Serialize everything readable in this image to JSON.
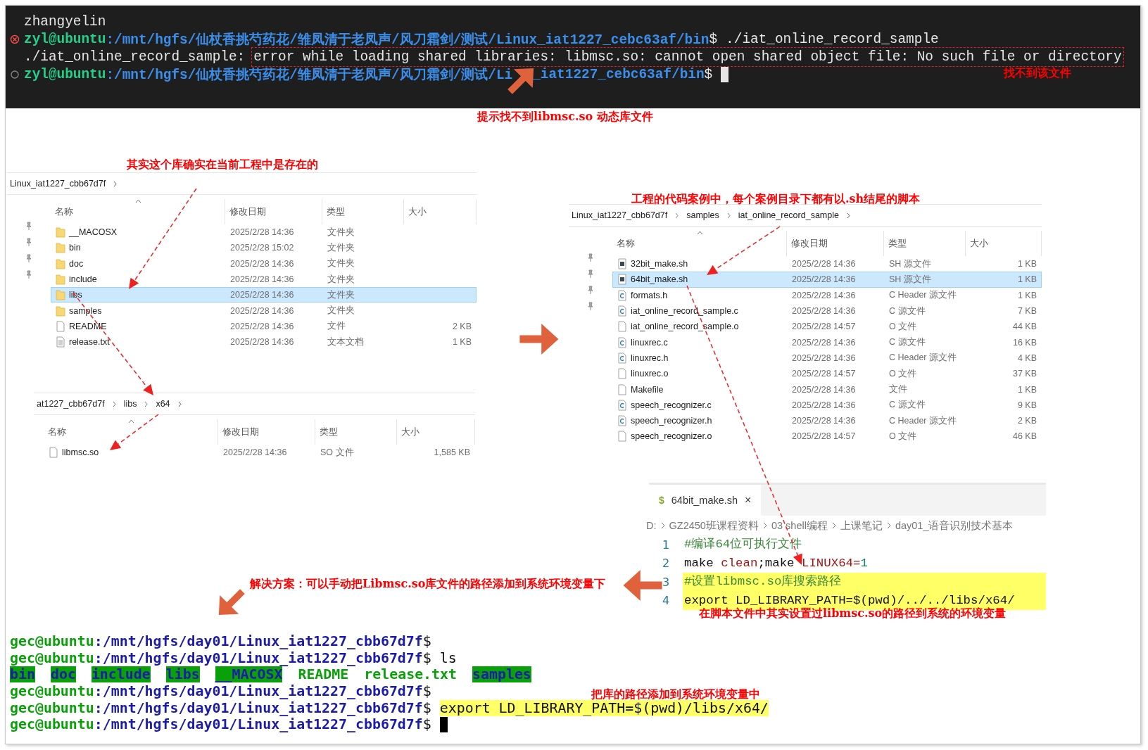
{
  "terminal_top": {
    "lines": [
      {
        "kind": "plain",
        "text": "zhangyelin"
      },
      {
        "kind": "failed-prompt",
        "user": "zyl@ubuntu",
        "path": ":/mnt/hgfs/仙杖香挑芍药花/雏凤清于老凤声/风刀霜剑/测试/Linux_iat1227_cebc63af/bin",
        "symbol": "$",
        "command": "./iat_online_record_sample"
      },
      {
        "kind": "output",
        "text": "./iat_online_record_sample:",
        "marked": "error while loading shared libraries: libmsc.so: cannot open shared object file: No such file or directory"
      },
      {
        "kind": "idle-prompt",
        "user": "zyl@ubuntu",
        "path": ":/mnt/hgfs/仙杖香挑芍药花/雏凤清于老凤声/风刀霜剑/测试/Li",
        "path_rest": "_iat1227_cebc63af/bin",
        "symbol": "$",
        "cursor": true
      }
    ]
  },
  "notes": [
    {
      "text": "找不到该文件"
    },
    {
      "text": "提示找不到libmsc.so 动态库文件"
    },
    {
      "text": "其实这个库确实在当前工程中是存在的"
    },
    {
      "text": "工程的代码案例中，每个案例目录下都有以.sh结尾的脚本"
    },
    {
      "text": "在脚本文件中其实设置过libmsc.so的路径到系统的环境变量"
    },
    {
      "text": "解决方案：可以手动把Libmsc.so库文件的路径添加到系统环境变量下"
    },
    {
      "text": "把库的路径添加到系统环境变量中"
    }
  ],
  "explorers": [
    {
      "breadcrumb": [
        "Linux_iat1227_cbb67d7f"
      ],
      "columns": [
        "名称",
        "修改日期",
        "类型",
        "大小"
      ],
      "rows": [
        {
          "kind": "folder",
          "name": "__MACOSX",
          "date": "2025/2/28 14:36",
          "type": "文件夹",
          "selected": false
        },
        {
          "kind": "folder",
          "name": "bin",
          "date": "2025/2/28 15:02",
          "type": "文件夹",
          "selected": false
        },
        {
          "kind": "folder",
          "name": "doc",
          "date": "2025/2/28 14:36",
          "type": "文件夹",
          "selected": false
        },
        {
          "kind": "folder",
          "name": "include",
          "date": "2025/2/28 14:36",
          "type": "文件夹",
          "selected": false
        },
        {
          "kind": "folder",
          "name": "libs",
          "date": "2025/2/28 14:36",
          "type": "文件夹",
          "selected": true
        },
        {
          "kind": "folder",
          "name": "samples",
          "date": "2025/2/28 14:36",
          "type": "文件夹",
          "selected": false
        },
        {
          "kind": "file",
          "name": "README",
          "date": "2025/2/28 14:36",
          "type": "文件",
          "size": "2 KB",
          "selected": false
        },
        {
          "kind": "text",
          "name": "release.txt",
          "date": "2025/2/28 14:36",
          "type": "文本文档",
          "size": "1 KB",
          "selected": false
        }
      ]
    },
    {
      "breadcrumb": [
        "at1227_cbb67d7f",
        "libs",
        "x64"
      ],
      "columns": [
        "名称",
        "修改日期",
        "类型",
        "大小"
      ],
      "rows": [
        {
          "kind": "file",
          "name": "libmsc.so",
          "date": "2025/2/28 14:36",
          "type": "SO 文件",
          "size": "1,585 KB",
          "selected": false
        }
      ]
    },
    {
      "breadcrumb": [
        "Linux_iat1227_cbb67d7f",
        "samples",
        "iat_online_record_sample"
      ],
      "columns": [
        "名称",
        "修改日期",
        "类型",
        "大小"
      ],
      "rows": [
        {
          "kind": "sh",
          "name": "32bit_make.sh",
          "date": "2025/2/28 14:36",
          "type": "SH 源文件",
          "size": "1 KB",
          "selected": false
        },
        {
          "kind": "sh",
          "name": "64bit_make.sh",
          "date": "2025/2/28 14:36",
          "type": "SH 源文件",
          "size": "1 KB",
          "selected": true
        },
        {
          "kind": "c",
          "name": "formats.h",
          "date": "2025/2/28 14:36",
          "type": "C Header 源文件",
          "size": "1 KB",
          "selected": false
        },
        {
          "kind": "c",
          "name": "iat_online_record_sample.c",
          "date": "2025/2/28 14:36",
          "type": "C 源文件",
          "size": "7 KB",
          "selected": false
        },
        {
          "kind": "file",
          "name": "iat_online_record_sample.o",
          "date": "2025/2/28 14:57",
          "type": "O 文件",
          "size": "44 KB",
          "selected": false
        },
        {
          "kind": "c",
          "name": "linuxrec.c",
          "date": "2025/2/28 14:36",
          "type": "C 源文件",
          "size": "16 KB",
          "selected": false
        },
        {
          "kind": "c",
          "name": "linuxrec.h",
          "date": "2025/2/28 14:36",
          "type": "C Header 源文件",
          "size": "4 KB",
          "selected": false
        },
        {
          "kind": "file",
          "name": "linuxrec.o",
          "date": "2025/2/28 14:57",
          "type": "O 文件",
          "size": "37 KB",
          "selected": false
        },
        {
          "kind": "file",
          "name": "Makefile",
          "date": "2025/2/28 14:36",
          "type": "文件",
          "size": "1 KB",
          "selected": false
        },
        {
          "kind": "c",
          "name": "speech_recognizer.c",
          "date": "2025/2/28 14:36",
          "type": "C 源文件",
          "size": "9 KB",
          "selected": false
        },
        {
          "kind": "c",
          "name": "speech_recognizer.h",
          "date": "2025/2/28 14:36",
          "type": "C Header 源文件",
          "size": "2 KB",
          "selected": false
        },
        {
          "kind": "file",
          "name": "speech_recognizer.o",
          "date": "2025/2/28 14:57",
          "type": "O 文件",
          "size": "46 KB",
          "selected": false
        }
      ]
    }
  ],
  "editor": {
    "tab": {
      "icon": "$",
      "label": "64bit_make.sh",
      "close": "×"
    },
    "breadcrumb": [
      "D:",
      "GZ2450班课程资料",
      "03 shell编程",
      "上课笔记",
      "day01_语音识别技术基本"
    ],
    "lines": [
      {
        "number": "1",
        "highlighted": false,
        "tokens": [
          {
            "kind": "comment",
            "text": "#编译64位可执行文件"
          }
        ]
      },
      {
        "number": "2",
        "highlighted": false,
        "tokens": [
          {
            "kind": "plain",
            "text": "make "
          },
          {
            "kind": "string",
            "text": "clean"
          },
          {
            "kind": "plain",
            "text": ";make "
          },
          {
            "kind": "string",
            "text": "LINUX64="
          },
          {
            "kind": "number",
            "text": "1"
          }
        ]
      },
      {
        "number": "3",
        "highlighted": true,
        "tokens": [
          {
            "kind": "comment",
            "text": "#设置libmsc.so库搜索路径"
          }
        ]
      },
      {
        "number": "4",
        "highlighted": true,
        "tokens": [
          {
            "kind": "plain",
            "text": "export LD_LIBRARY_PATH=$(pwd)/../../libs/x64/"
          }
        ]
      }
    ]
  },
  "terminal_bottom": {
    "lines": [
      {
        "kind": "prompt",
        "user": "gec@ubuntu",
        "path": ":/mnt/hgfs/day01/Linux_iat1227_cbb67d7f",
        "symbol": "$"
      },
      {
        "kind": "prompt",
        "user": "gec@ubuntu",
        "path": ":/mnt/hgfs/day01/Linux_iat1227_cbb67d7f",
        "symbol": "$",
        "command": "ls"
      },
      {
        "kind": "listing",
        "items": [
          {
            "kind": "dir",
            "text": "bin"
          },
          {
            "kind": "dir",
            "text": "doc"
          },
          {
            "kind": "dir",
            "text": "include"
          },
          {
            "kind": "dir",
            "text": "libs"
          },
          {
            "kind": "dir",
            "text": "__MACOSX"
          },
          {
            "kind": "file",
            "text": "README"
          },
          {
            "kind": "file",
            "text": "release.txt"
          },
          {
            "kind": "dir",
            "text": "samples"
          }
        ]
      },
      {
        "kind": "prompt",
        "user": "gec@ubuntu",
        "path": ":/mnt/hgfs/day01/Linux_iat1227_cbb67d7f",
        "symbol": "$"
      },
      {
        "kind": "prompt",
        "user": "gec@ubuntu",
        "path": ":/mnt/hgfs/day01/Linux_iat1227_cbb67d7f",
        "symbol": "$",
        "marked": "export LD_LIBRARY_PATH=$(pwd)/libs/x64/"
      },
      {
        "kind": "prompt",
        "user": "gec@ubuntu",
        "path": ":/mnt/hgfs/day01/Linux_iat1227_cbb67d7f",
        "symbol": "$",
        "cursor": true
      }
    ]
  }
}
